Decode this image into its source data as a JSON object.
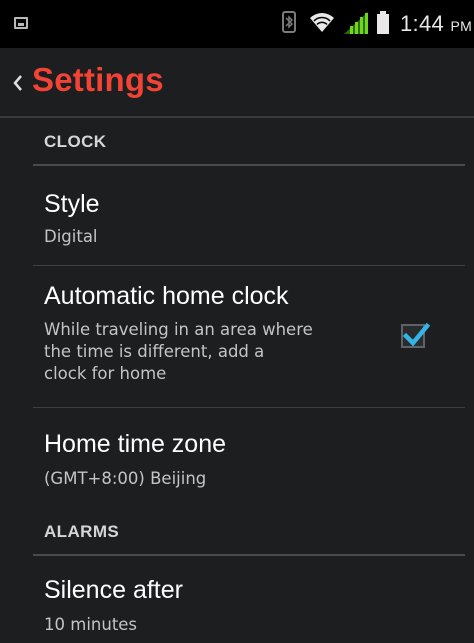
{
  "status_bar": {
    "time": "1:44",
    "ampm": "PM",
    "icons": [
      "notification-icon",
      "bluetooth-icon",
      "wifi-icon",
      "signal-icon",
      "battery-icon"
    ]
  },
  "action_bar": {
    "title": "Settings",
    "back_icon": "chevron-left-icon"
  },
  "sections": [
    {
      "header": "CLOCK",
      "items": [
        {
          "title": "Style",
          "summary": "Digital"
        },
        {
          "title": "Automatic home clock",
          "summary_lines": [
            "While traveling in an area where",
            "the time is different, add a",
            "clock for home"
          ],
          "checkbox": {
            "checked": true
          }
        },
        {
          "title": "Home time zone",
          "summary": "(GMT+8:00) Beijing"
        }
      ]
    },
    {
      "header": "ALARMS",
      "items": [
        {
          "title": "Silence after",
          "summary": "10 minutes"
        }
      ]
    }
  ],
  "colors": {
    "accent": "#f24334",
    "check": "#33b5e5",
    "background": "#1d1e20",
    "status_bar": "#000000"
  }
}
